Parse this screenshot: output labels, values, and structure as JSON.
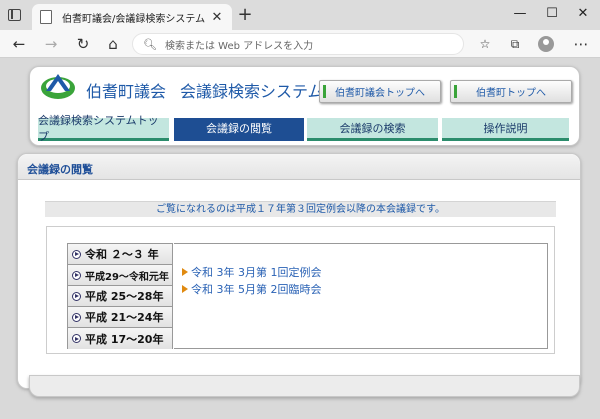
{
  "browser": {
    "tab_title": "伯耆町議会/会議録検索システム",
    "address_placeholder": "検索または Web アドレスを入力"
  },
  "header": {
    "site_name": "伯耆町議会",
    "system_name": "会議録検索システム",
    "links": [
      "伯耆町議会トップへ",
      "伯耆町トップへ"
    ]
  },
  "nav": {
    "items": [
      "会議録検索システムトップ",
      "会議録の閲覧",
      "会議録の検索",
      "操作説明"
    ],
    "active_index": 1
  },
  "section_title": "会議録の閲覧",
  "notice": "ご覧になれるのは平成１７年第３回定例会以降の本会議録です。",
  "years": [
    "令和 ２～３ 年",
    "平成29～令和元年",
    "平成 25～28年",
    "平成 21～24年",
    "平成 17～20年"
  ],
  "meetings": [
    "令和 3年 3月第 1回定例会",
    "令和 3年 5月第 2回臨時会"
  ],
  "colors": {
    "brand": "#1f5aa8",
    "nav_active": "#1e4e93",
    "nav_inactive": "#c3e6df",
    "arrow": "#e08a10"
  }
}
